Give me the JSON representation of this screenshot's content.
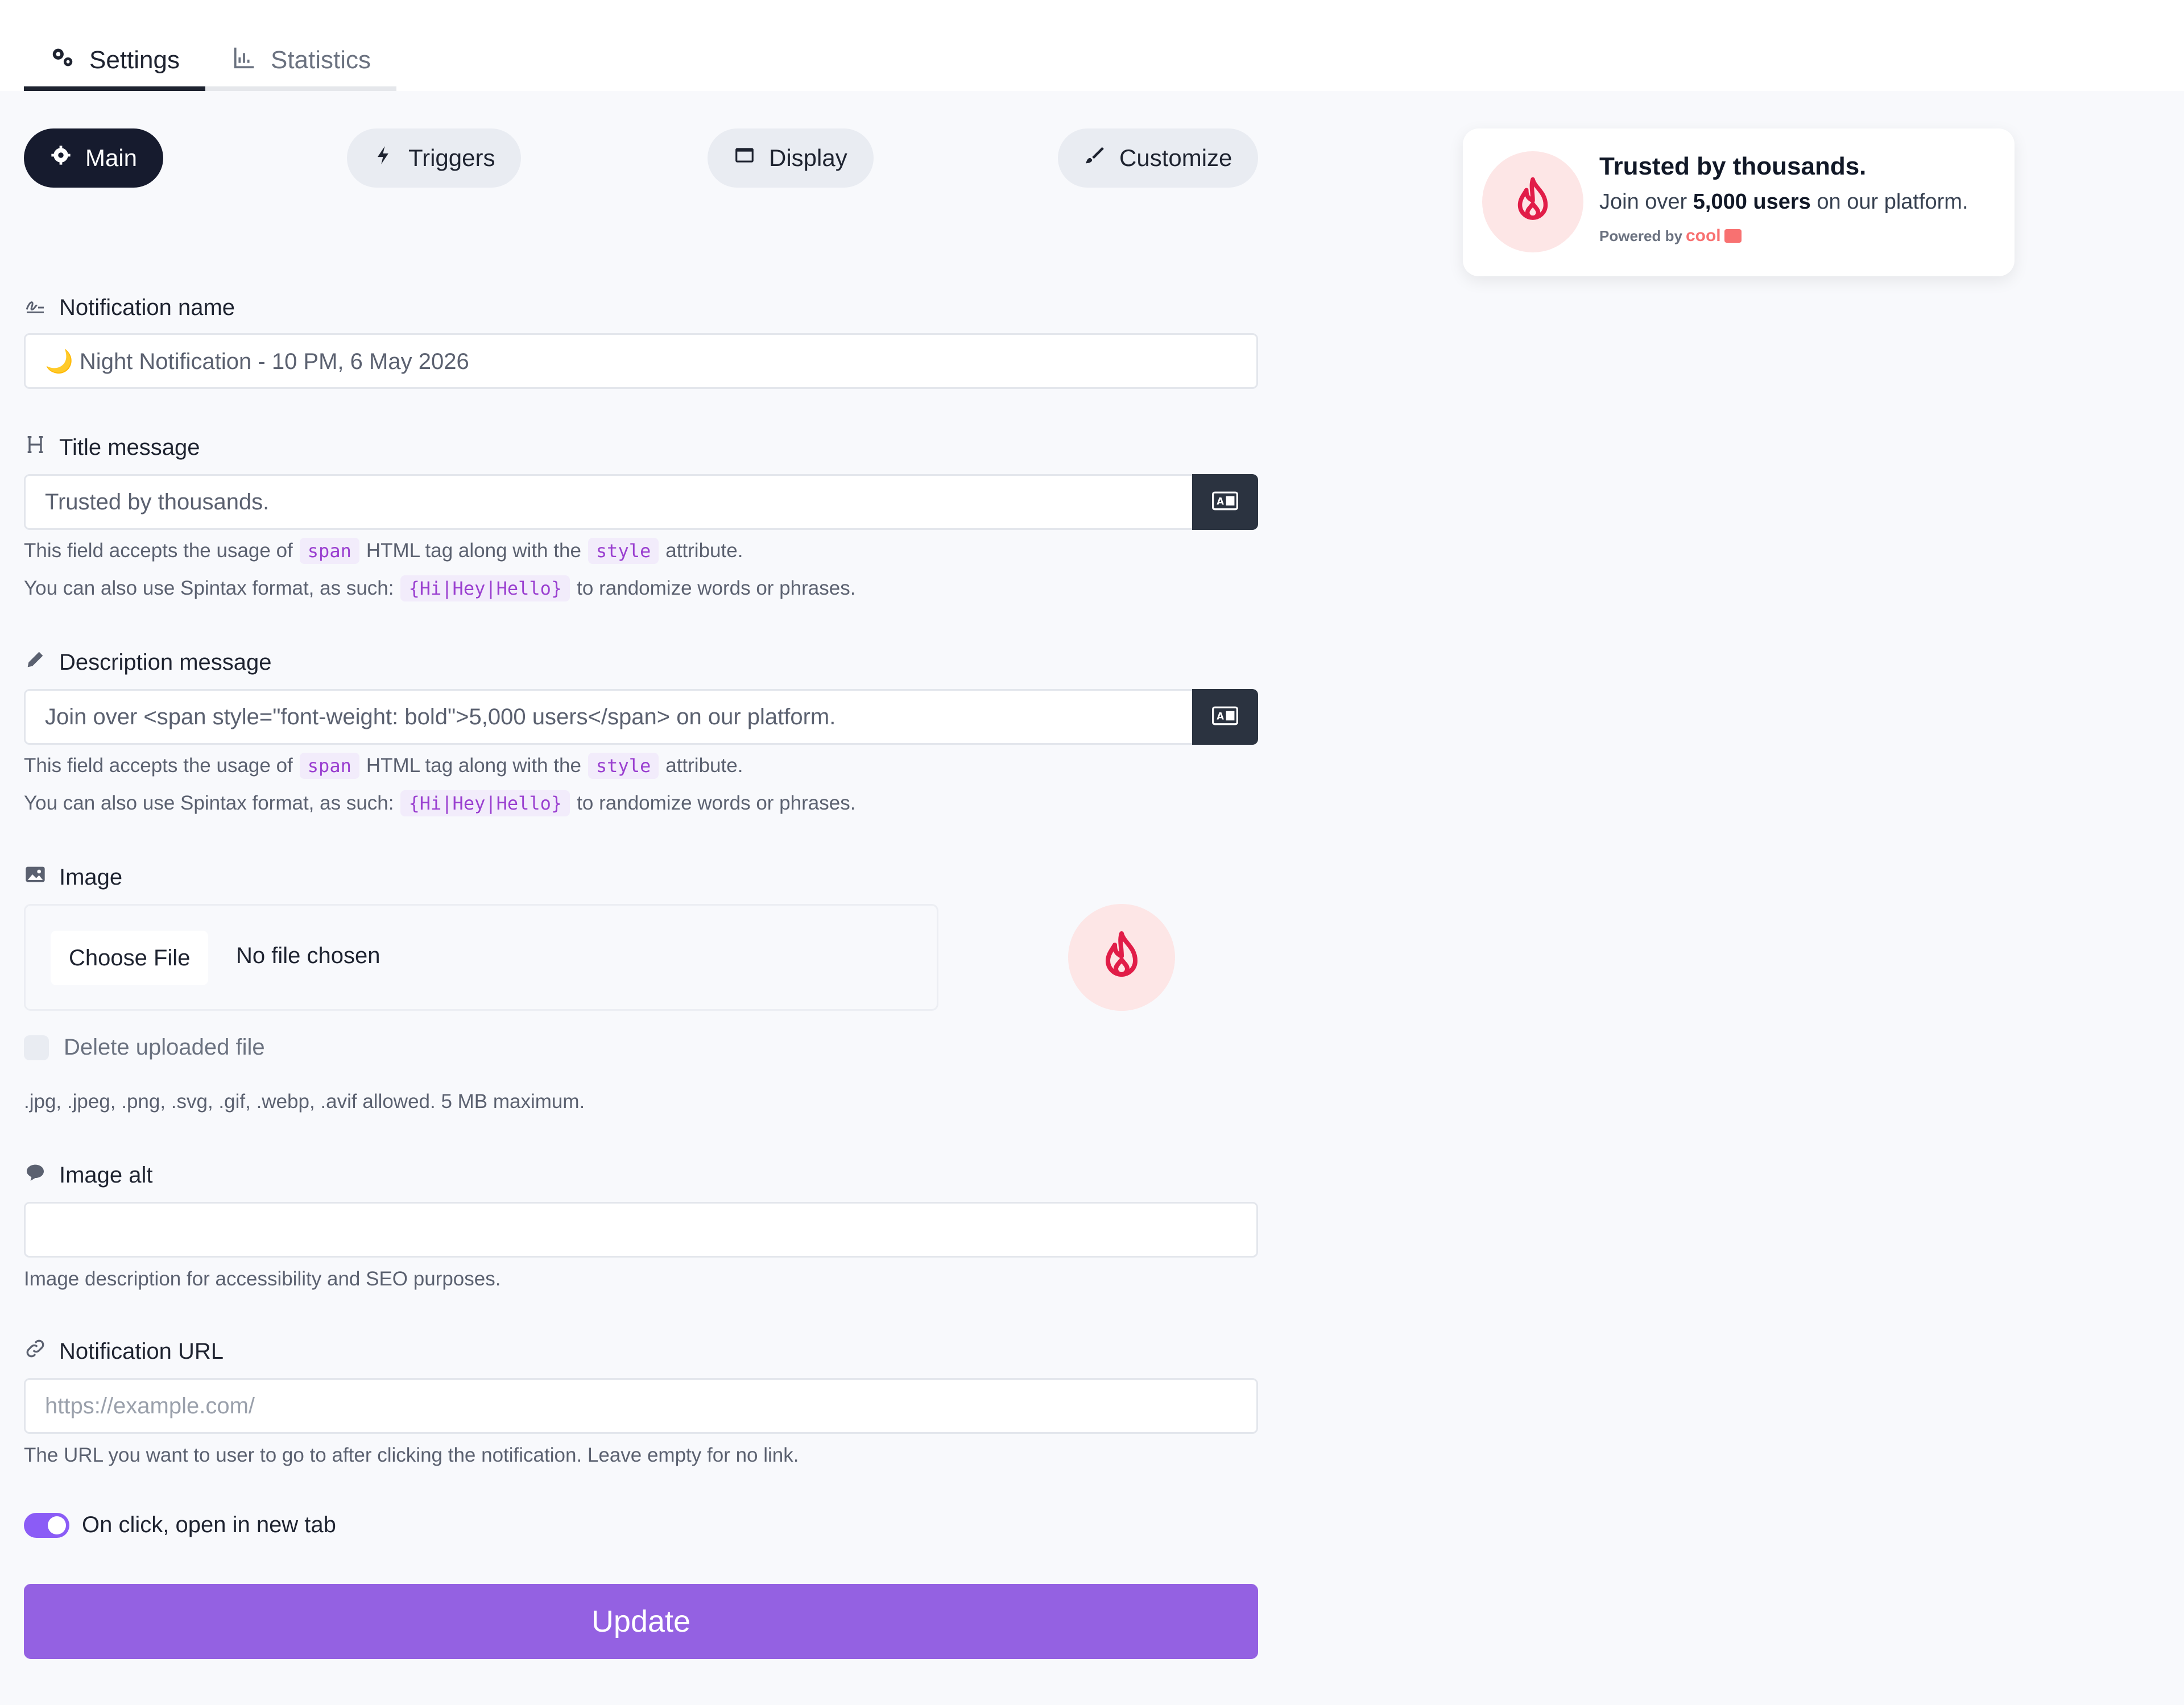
{
  "tabs": [
    {
      "label": "Settings",
      "icon": "gears-icon",
      "active": true
    },
    {
      "label": "Statistics",
      "icon": "chart-icon",
      "active": false
    }
  ],
  "pills": [
    {
      "label": "Main",
      "icon": "gear-icon",
      "active": true
    },
    {
      "label": "Triggers",
      "icon": "bolt-icon",
      "active": false
    },
    {
      "label": "Display",
      "icon": "window-icon",
      "active": false
    },
    {
      "label": "Customize",
      "icon": "brush-icon",
      "active": false
    }
  ],
  "fields": {
    "name": {
      "label": "Notification name",
      "value": "🌙 Night Notification - 10 PM, 6 May 2026"
    },
    "title": {
      "label": "Title message",
      "value": "Trusted by thousands.",
      "help1_a": "This field accepts the usage of",
      "help1_code1": "span",
      "help1_b": "HTML tag along with the",
      "help1_code2": "style",
      "help1_c": "attribute.",
      "help2_a": "You can also use Spintax format, as such:",
      "help2_code": "{Hi|Hey|Hello}",
      "help2_b": "to randomize words or phrases."
    },
    "description": {
      "label": "Description message",
      "value": "Join over <span style=\"font-weight: bold\">5,000 users</span> on our platform.",
      "help1_a": "This field accepts the usage of",
      "help1_code1": "span",
      "help1_b": "HTML tag along with the",
      "help1_code2": "style",
      "help1_c": "attribute.",
      "help2_a": "You can also use Spintax format, as such:",
      "help2_code": "{Hi|Hey|Hello}",
      "help2_b": "to randomize words or phrases."
    },
    "image": {
      "label": "Image",
      "choose_label": "Choose File",
      "status": "No file chosen",
      "delete_label": "Delete uploaded file",
      "help": ".jpg, .jpeg, .png, .svg, .gif, .webp, .avif allowed. 5 MB maximum."
    },
    "image_alt": {
      "label": "Image alt",
      "value": "",
      "help": "Image description for accessibility and SEO purposes."
    },
    "url": {
      "label": "Notification URL",
      "placeholder": "https://example.com/",
      "help": "The URL you want to user to go to after clicking the notification. Leave empty for no link."
    },
    "new_tab": {
      "label": "On click, open in new tab",
      "checked": true
    }
  },
  "update_label": "Update",
  "preview": {
    "title": "Trusted by thousands.",
    "desc_a": "Join over",
    "desc_bold": "5,000 users",
    "desc_b": "on our platform.",
    "powered_by": "Powered by",
    "brand": "cool"
  },
  "colors": {
    "accent": "#9461e2",
    "dark": "#161b2e",
    "flame": "#e11d48"
  }
}
